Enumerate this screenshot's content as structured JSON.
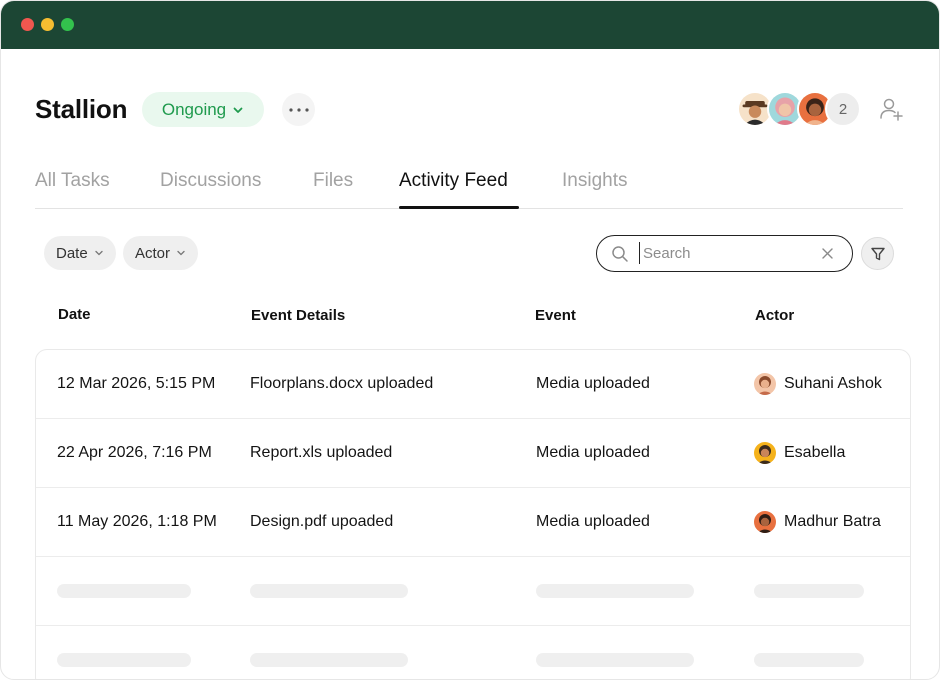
{
  "project": {
    "title": "Stallion",
    "status": "Ongoing",
    "member_overflow": "2"
  },
  "tabs": [
    {
      "label": "All Tasks",
      "active": false
    },
    {
      "label": "Discussions",
      "active": false
    },
    {
      "label": "Files",
      "active": false
    },
    {
      "label": "Activity Feed",
      "active": true
    },
    {
      "label": "Insights",
      "active": false
    }
  ],
  "filters": {
    "date_label": "Date",
    "actor_label": "Actor"
  },
  "search": {
    "placeholder": "Search",
    "value": ""
  },
  "table": {
    "headers": [
      "Date",
      "Event Details",
      "Event",
      "Actor"
    ],
    "rows": [
      {
        "date": "12 Mar 2026, 5:15 PM",
        "details": "Floorplans.docx uploaded",
        "event": "Media uploaded",
        "actor": "Suhani Ashok",
        "actor_color": "#f3c5a8"
      },
      {
        "date": "22 Apr 2026, 7:16 PM",
        "details": "Report.xls uploaded",
        "event": "Media uploaded",
        "actor": "Esabella",
        "actor_color": "#f5b21b"
      },
      {
        "date": "11 May 2026, 1:18 PM",
        "details": "Design.pdf upoaded",
        "event": "Media uploaded",
        "actor": "Madhur Batra",
        "actor_color": "#e8703f"
      }
    ]
  },
  "colors": {
    "titlebar": "#1c4634",
    "status_bg": "#e9f8ee",
    "status_text": "#1f9a4d"
  },
  "icons": {
    "status_chevron": "chevron-down-icon",
    "more": "more-horizontal-icon",
    "add_member": "add-user-icon",
    "search": "search-icon",
    "clear": "close-icon",
    "filter": "filter-icon"
  }
}
